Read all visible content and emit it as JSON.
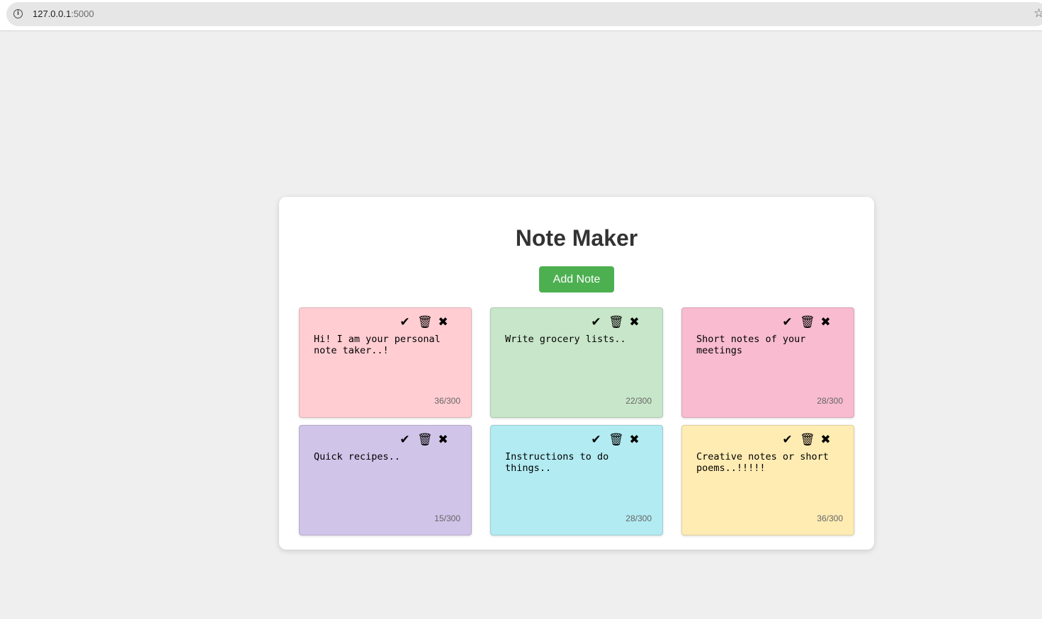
{
  "browser": {
    "url_host": "127.0.0.1",
    "url_port": ":5000"
  },
  "app": {
    "title": "Note Maker",
    "add_button_label": "Add Note"
  },
  "icons": {
    "check": "✔",
    "trash": "🗑",
    "close": "✖",
    "info": "i",
    "star": "☆"
  },
  "notes": [
    {
      "text": "Hi! I am your personal note taker..!",
      "count": "36/300",
      "color": "#ffcdd2"
    },
    {
      "text": "Write grocery lists..",
      "count": "22/300",
      "color": "#c8e6c9"
    },
    {
      "text": "Short notes of your meetings",
      "count": "28/300",
      "color": "#f8bbd0"
    },
    {
      "text": "Quick recipes..",
      "count": "15/300",
      "color": "#d1c4e9"
    },
    {
      "text": "Instructions to do things..",
      "count": "28/300",
      "color": "#b2ebf2"
    },
    {
      "text": "Creative notes or short poems..!!!!!",
      "count": "36/300",
      "color": "#ffecb3"
    }
  ]
}
